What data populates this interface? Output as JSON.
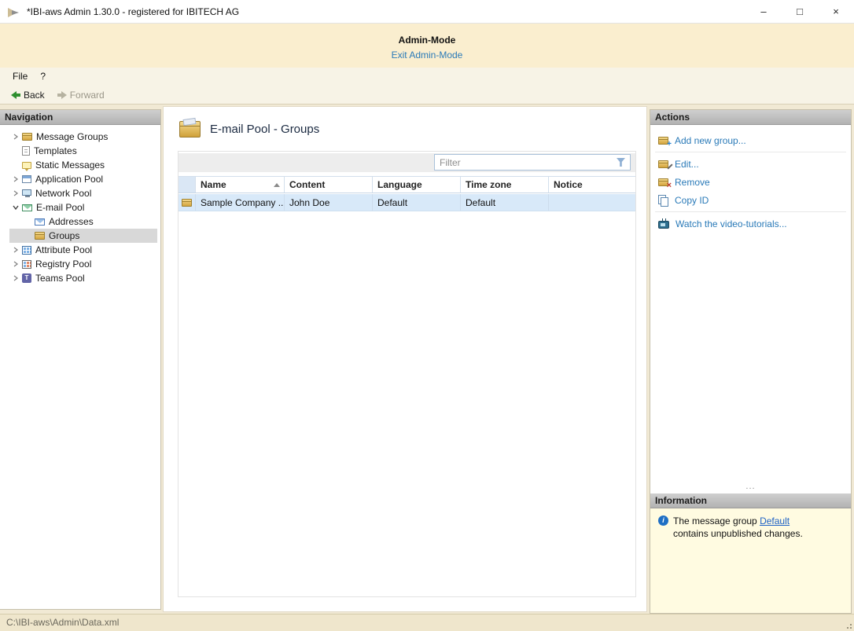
{
  "window": {
    "title": "*IBI-aws Admin 1.30.0 - registered for IBITECH AG",
    "controls": {
      "minimize": "–",
      "maximize": "□",
      "close": "×"
    }
  },
  "admin_banner": {
    "title": "Admin-Mode",
    "exit_link": "Exit Admin-Mode"
  },
  "menu": {
    "file": "File",
    "help": "?"
  },
  "toolbar": {
    "back_label": "Back",
    "forward_label": "Forward"
  },
  "navigation": {
    "header": "Navigation",
    "items": [
      {
        "label": "Message Groups",
        "icon": "package-icon",
        "state": "collapsed"
      },
      {
        "label": "Templates",
        "icon": "document-icon",
        "state": "leaf"
      },
      {
        "label": "Static Messages",
        "icon": "message-icon",
        "state": "leaf"
      },
      {
        "label": "Application Pool",
        "icon": "window-icon",
        "state": "collapsed"
      },
      {
        "label": "Network Pool",
        "icon": "monitor-icon",
        "state": "collapsed"
      },
      {
        "label": "E-mail Pool",
        "icon": "envelope-pool-icon",
        "state": "expanded"
      },
      {
        "label": "Addresses",
        "icon": "envelope-icon",
        "state": "leaf",
        "indent": 1
      },
      {
        "label": "Groups",
        "icon": "package-icon",
        "state": "leaf",
        "indent": 1,
        "selected": true
      },
      {
        "label": "Attribute Pool",
        "icon": "grid-icon",
        "state": "collapsed"
      },
      {
        "label": "Registry Pool",
        "icon": "registry-icon",
        "state": "collapsed"
      },
      {
        "label": "Teams Pool",
        "icon": "teams-icon",
        "state": "collapsed"
      }
    ]
  },
  "main": {
    "title": "E-mail Pool - Groups",
    "filter_placeholder": "Filter",
    "table": {
      "columns": [
        "Name",
        "Content",
        "Language",
        "Time zone",
        "Notice"
      ],
      "sort": {
        "column": "Name",
        "direction": "ascending"
      },
      "rows": [
        {
          "name": "Sample Company ...",
          "content": "John Doe",
          "language": "Default",
          "time_zone": "Default",
          "notice": ""
        }
      ]
    }
  },
  "actions": {
    "header": "Actions",
    "items": [
      {
        "label": "Add new group...",
        "icon": "package-add-icon"
      },
      {
        "label": "Edit...",
        "icon": "package-edit-icon"
      },
      {
        "label": "Remove",
        "icon": "package-remove-icon"
      },
      {
        "label": "Copy ID",
        "icon": "copy-icon"
      },
      {
        "label": "Watch the video-tutorials...",
        "icon": "tv-icon"
      }
    ],
    "overflow_indicator": "..."
  },
  "information": {
    "header": "Information",
    "message_before": "The message group ",
    "link": "Default",
    "message_after": " contains unpublished changes."
  },
  "statusbar": {
    "path": "C:\\IBI-aws\\Admin\\Data.xml"
  },
  "colors": {
    "link_blue": "#2a7ab8",
    "info_link_blue": "#1f62c5",
    "selection_blue": "#d8e9f9",
    "banner_bg": "#faeecf",
    "info_bg": "#fffbe1"
  }
}
